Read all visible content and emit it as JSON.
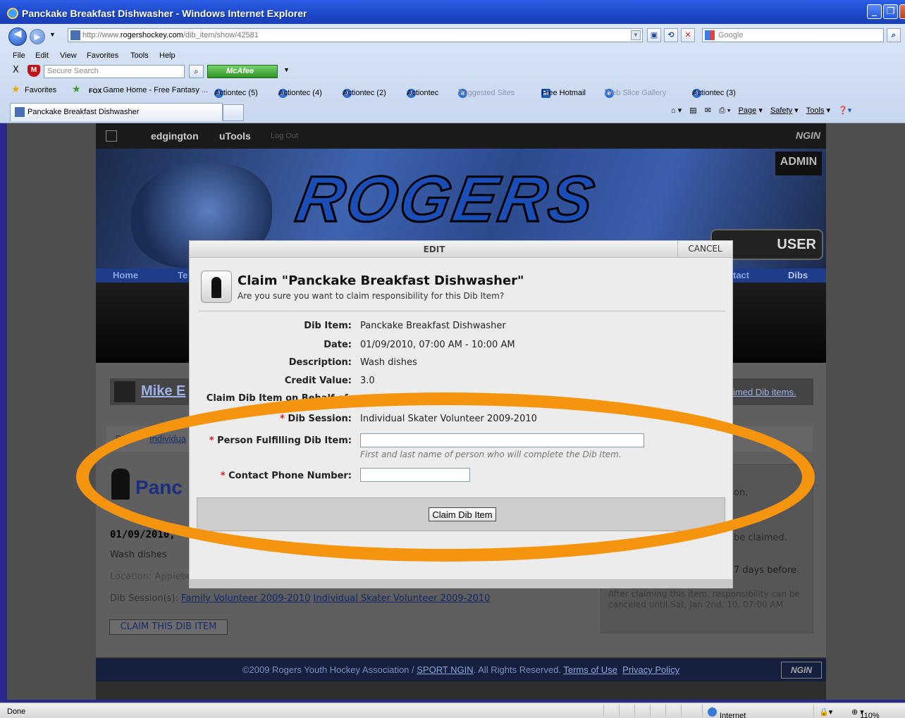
{
  "window": {
    "title": "Panckake Breakfast Dishwasher - Windows Internet Explorer",
    "minimize_glyph": "_",
    "maximize_glyph": "❐",
    "close_glyph": "X"
  },
  "address": {
    "url_prefix": "http://www.",
    "url_domain": "rogershockey.com",
    "url_path": "/dib_item/show/42581"
  },
  "search": {
    "placeholder": "Google"
  },
  "menu": [
    "File",
    "Edit",
    "View",
    "Favorites",
    "Tools",
    "Help"
  ],
  "mcafee_bar": {
    "close": "X",
    "secure_search_placeholder": "Secure Search",
    "brand": "McAfee",
    "shield_letter": "M"
  },
  "favorites_bar": {
    "favorites_label": "Favorites",
    "items": [
      "Game Home - Free Fantasy ...",
      "Actiontec (5)",
      "Actiontec (4)",
      "Actiontec (2)",
      "Actiontec",
      "Suggested Sites",
      "Free Hotmail",
      "Web Slice Gallery",
      "Actiontec (3)"
    ],
    "fox_label": "FOX"
  },
  "tab": {
    "label": "Panckake Breakfast Dishwasher"
  },
  "commands": [
    "Page",
    "Safety",
    "Tools"
  ],
  "site": {
    "topnav": {
      "user": "edgington",
      "utools": "uTools",
      "logout": "Log Out",
      "ngin": "NGIN"
    },
    "banner": {
      "logo": "ROGERS",
      "admin": "ADMIN",
      "usermode": "USER"
    },
    "nav": [
      "Home",
      "Te",
      "tact",
      "Dibs"
    ],
    "user_name": "Mike E",
    "claimed_link": "imed Dib items.",
    "row_text": "Dib",
    "row_link": "Individua",
    "item_title": "Panc",
    "item_date": "01/09/2010,",
    "item_desc": "Wash dishes",
    "item_location": "Location: Applebe",
    "sessions_label": "Dib Session(s):",
    "session_links": [
      "Family Volunteer 2009-2010",
      "Individual Skater Volunteer 2009-2010"
    ],
    "claim_button": "CLAIM THIS DIB ITEM",
    "side": {
      "t1": "on.",
      "t2": "be claimed.",
      "t3": "7 days before",
      "t4": "After claiming this item, responsibility can be canceled until Sat, Jan 2nd, 10, 07:00 AM"
    },
    "footer": {
      "copyright": "©2009 Rogers Youth Hockey Association / ",
      "sport_ngin": "SPORT NGIN",
      "rights": ". All Rights Reserved. ",
      "terms": "Terms of Use",
      "privacy": "Privacy Policy",
      "ngin": "NGIN"
    }
  },
  "modal": {
    "header": "EDIT",
    "cancel": "CANCEL",
    "title": "Claim \"Panckake Breakfast Dishwasher\"",
    "subtitle": "Are you sure you want to claim responsibility for this Dib Item?",
    "fields": {
      "dib_item_label": "Dib Item:",
      "dib_item_value": "Panckake Breakfast Dishwasher",
      "date_label": "Date:",
      "date_value": "01/09/2010, 07:00 AM - 10:00 AM",
      "description_label": "Description:",
      "description_value": "Wash dishes",
      "credit_label": "Credit Value:",
      "credit_value": "3.0",
      "behalf_label": "Claim Dib Item on Behalf of:",
      "session_label": "Dib Session:",
      "session_value": "Individual Skater Volunteer 2009-2010",
      "person_label": "Person Fulfilling Dib Item:",
      "person_value": "",
      "person_hint": "First and last name of person who will complete the Dib Item.",
      "phone_label": "Contact Phone Number:",
      "phone_value": "",
      "required_mark": "*"
    },
    "submit": "Claim Dib Item"
  },
  "status": {
    "left": "Done",
    "zone": "Internet",
    "zoom": "110%"
  },
  "colors": {
    "annotation": "#f5950f",
    "title_bar": "#1c47c9",
    "required": "#cc1f1f"
  }
}
